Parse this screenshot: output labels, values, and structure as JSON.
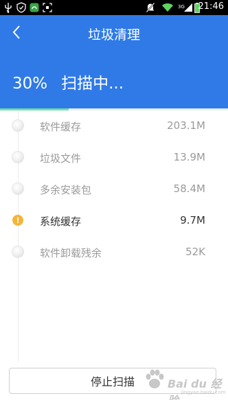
{
  "status_bar": {
    "time": "21:46",
    "network": "3G",
    "icons": [
      "usb-icon",
      "shield-icon",
      "app-icon",
      "screenshot-icon",
      "mute-icon",
      "wifi-icon",
      "signal-icon",
      "battery-icon"
    ]
  },
  "header": {
    "title": "垃圾清理",
    "percent": "30%",
    "status": "扫描中...",
    "progress": 0.3,
    "colors": {
      "background": "#2f7ae6",
      "progress": "#6fe0a6"
    }
  },
  "items": [
    {
      "label": "软件缓存",
      "size": "203.1M",
      "state": "pending"
    },
    {
      "label": "垃圾文件",
      "size": "13.9M",
      "state": "pending"
    },
    {
      "label": "多余安装包",
      "size": "58.4M",
      "state": "pending"
    },
    {
      "label": "系统缓存",
      "size": "9.7M",
      "state": "warning"
    },
    {
      "label": "软件卸载残余",
      "size": "52K",
      "state": "pending"
    }
  ],
  "stop_button": {
    "label": "停止扫描"
  },
  "watermark": {
    "text": "Bai du 经验",
    "sub": "jingyan.baidu.com"
  }
}
